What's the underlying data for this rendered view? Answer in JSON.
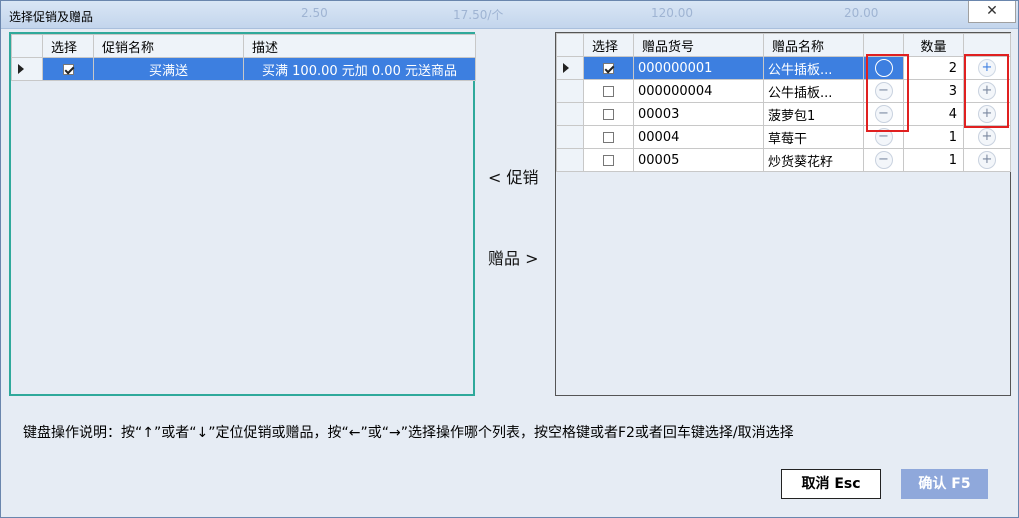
{
  "window": {
    "title": "选择促销及赠品",
    "background_texts": [
      "2.50",
      "17.50/个",
      "120.00",
      "20.00"
    ],
    "close_glyph": "✕"
  },
  "promotions": {
    "columns": [
      "选择",
      "促销名称",
      "描述"
    ],
    "rows": [
      {
        "checked": true,
        "name": "买满送",
        "desc": "买满 100.00 元加 0.00 元送商品"
      }
    ]
  },
  "mid": {
    "promo_label": "< 促销",
    "gift_label": "赠品 >"
  },
  "gifts": {
    "columns": [
      "选择",
      "赠品货号",
      "赠品名称",
      "",
      "数量",
      ""
    ],
    "rows": [
      {
        "checked": true,
        "code": "000000001",
        "name": "公牛插板...",
        "qty": "2"
      },
      {
        "checked": false,
        "code": "000000004",
        "name": "公牛插板...",
        "qty": "3"
      },
      {
        "checked": false,
        "code": "00003",
        "name": "菠萝包1",
        "qty": "4"
      },
      {
        "checked": false,
        "code": "00004",
        "name": "草莓干",
        "qty": "1"
      },
      {
        "checked": false,
        "code": "00005",
        "name": "炒货葵花籽",
        "qty": "1"
      }
    ],
    "minus_glyph": "−",
    "plus_glyph": "+"
  },
  "hint": "键盘操作说明：按“↑”或者“↓”定位促销或赠品，按“←”或“→”选择操作哪个列表，按空格键或者F2或者回车键选择/取消选择",
  "buttons": {
    "cancel": "取消 Esc",
    "ok": "确认 F5"
  },
  "colors": {
    "selected_row": "#3d7fe0",
    "left_panel_border": "#2fa99b",
    "highlight_box": "#e02020",
    "ok_button": "#8fa8db"
  }
}
